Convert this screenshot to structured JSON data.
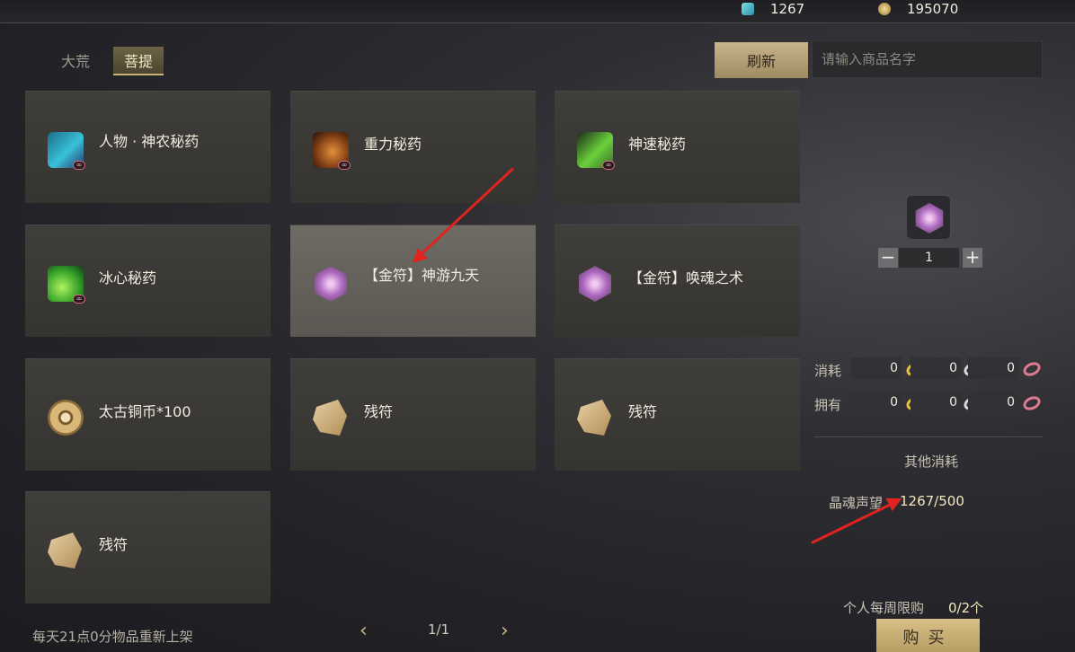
{
  "currency": {
    "jade": "1267",
    "coins": "195070"
  },
  "tabs": [
    {
      "label": "大荒"
    },
    {
      "label": "菩提"
    }
  ],
  "toolbar": {
    "refresh_label": "刷新",
    "search_placeholder": "请输入商品名字"
  },
  "items": [
    {
      "name": "人物 · 神农秘药"
    },
    {
      "name": "重力秘药"
    },
    {
      "name": "神速秘药"
    },
    {
      "name": "冰心秘药"
    },
    {
      "name": "【金符】神游九天"
    },
    {
      "name": "【金符】唤魂之术"
    },
    {
      "name": "太古铜币*100"
    },
    {
      "name": "残符"
    },
    {
      "name": "残符"
    },
    {
      "name": "残符"
    }
  ],
  "infinite_mark": "∞",
  "detail": {
    "quantity": "1",
    "minus": "−",
    "plus": "+",
    "cost_label": "消耗",
    "own_label": "拥有",
    "cost_values": [
      "0",
      "0",
      "0"
    ],
    "own_values": [
      "0",
      "0",
      "0"
    ],
    "other_cost_title": "其他消耗",
    "reputation_label": "晶魂声望",
    "reputation_value": "1267/500",
    "weekly_limit_label": "个人每周限购",
    "weekly_limit_value": "0/2个",
    "buy_label": "购买"
  },
  "footer": {
    "note": "每天21点0分物品重新上架",
    "page": "1/1",
    "prev": "‹",
    "next": "›"
  }
}
